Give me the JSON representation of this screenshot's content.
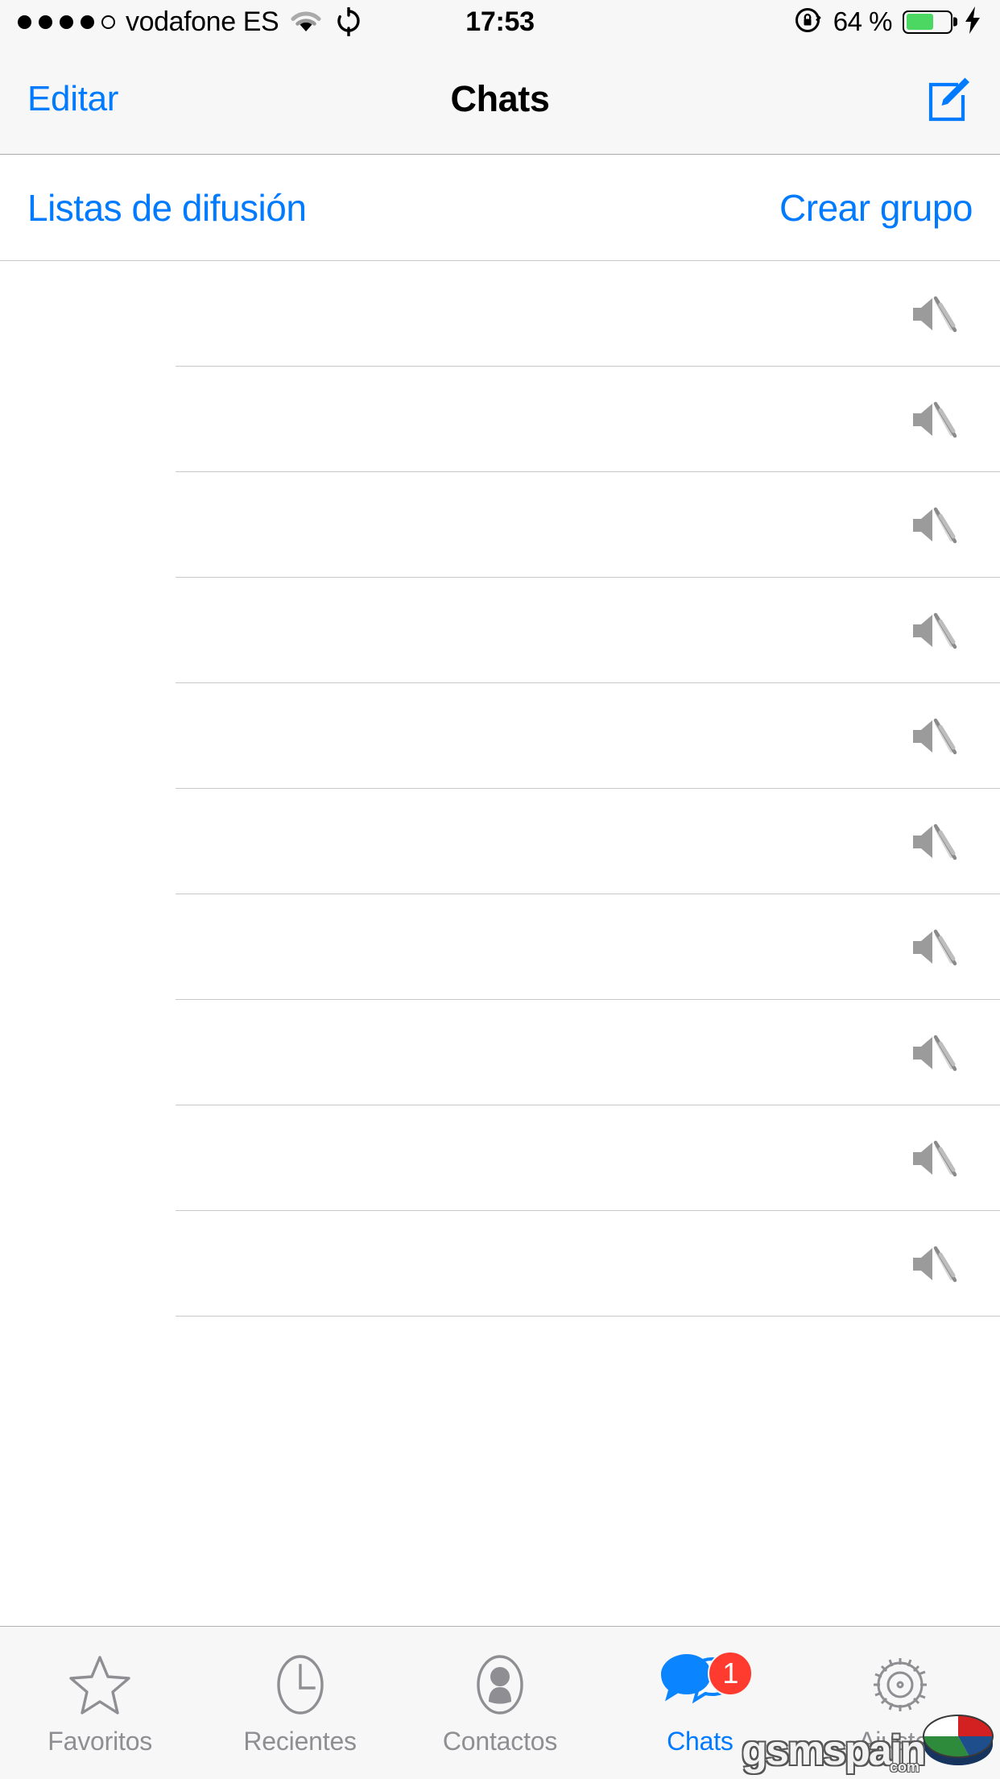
{
  "status_bar": {
    "signal_dots_filled": 4,
    "signal_dots_empty": 1,
    "carrier": "vodafone ES",
    "wifi_icon": "wifi-icon",
    "sync_icon": "sync-rotate-icon",
    "time": "17:53",
    "rotation_lock_icon": "rotation-lock-icon",
    "battery_percent_label": "64 %",
    "battery_level": 64,
    "battery_color": "#4CD763",
    "charging_icon": "lightning-bolt-icon"
  },
  "nav_bar": {
    "left_button": "Editar",
    "title": "Chats",
    "right_icon": "compose-new-chat-icon",
    "tint_color": "#007AFF",
    "background": "#F7F7F7"
  },
  "action_row": {
    "broadcast_lists": "Listas de difusión",
    "create_group": "Crear grupo"
  },
  "chat_list": {
    "mute_icon": "speaker-muted-icon",
    "rows": [
      {
        "name": "",
        "message": "",
        "muted": true
      },
      {
        "name": "",
        "message": "",
        "muted": true
      },
      {
        "name": "",
        "message": "",
        "muted": true
      },
      {
        "name": "",
        "message": "",
        "muted": true
      },
      {
        "name": "",
        "message": "",
        "muted": true
      },
      {
        "name": "",
        "message": "",
        "muted": true
      },
      {
        "name": "",
        "message": "",
        "muted": true
      },
      {
        "name": "",
        "message": "",
        "muted": true
      },
      {
        "name": "",
        "message": "",
        "muted": true
      },
      {
        "name": "",
        "message": "",
        "muted": true
      }
    ]
  },
  "tab_bar": {
    "background": "#F7F7F7",
    "active_color": "#007AFF",
    "inactive_color": "#8E8E93",
    "badge_color": "#FF3B30",
    "tabs": [
      {
        "label": "Favoritos",
        "icon": "star-icon",
        "active": false,
        "badge": ""
      },
      {
        "label": "Recientes",
        "icon": "clock-icon",
        "active": false,
        "badge": ""
      },
      {
        "label": "Contactos",
        "icon": "person-icon",
        "active": false,
        "badge": ""
      },
      {
        "label": "Chats",
        "icon": "speech-bubbles-icon",
        "active": true,
        "badge": "1"
      },
      {
        "label": "Ajustes",
        "icon": "gear-icon",
        "active": false,
        "badge": ""
      }
    ]
  },
  "watermark": {
    "text": "gsmspain",
    "suffix": "com",
    "logo_icon": "pie-chart-logo",
    "logo_colors": [
      "#D32020",
      "#1F4E8C",
      "#2E8B3C",
      "#FFFFFF"
    ]
  }
}
